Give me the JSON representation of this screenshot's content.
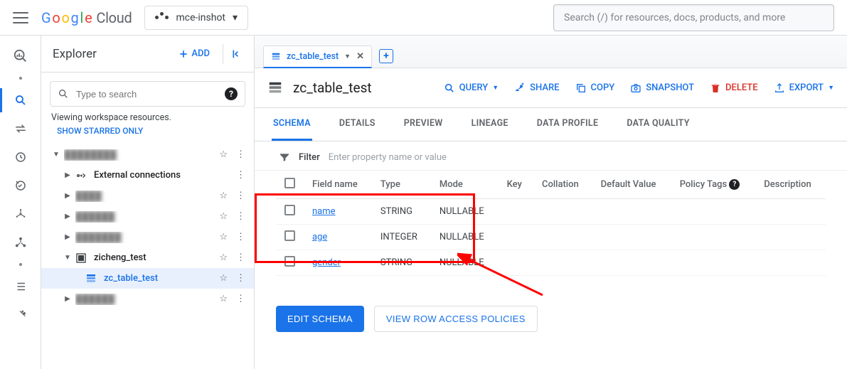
{
  "top": {
    "logo_cloud": "Cloud",
    "project": "mce-inshot",
    "search_placeholder": "Search (/) for resources, docs, products, and more"
  },
  "explorer": {
    "title": "Explorer",
    "add": "ADD",
    "search_placeholder": "Type to search",
    "viewing": "Viewing workspace resources.",
    "starred": "SHOW STARRED ONLY",
    "ext_conn": "External connections",
    "ds": "zicheng_test",
    "tbl": "zc_table_test"
  },
  "main": {
    "tab_label": "zc_table_test",
    "title": "zc_table_test",
    "actions": {
      "query": "QUERY",
      "share": "SHARE",
      "copy": "COPY",
      "snapshot": "SNAPSHOT",
      "delete": "DELETE",
      "export": "EXPORT"
    },
    "subtabs": [
      "SCHEMA",
      "DETAILS",
      "PREVIEW",
      "LINEAGE",
      "DATA PROFILE",
      "DATA QUALITY"
    ],
    "filter_label": "Filter",
    "filter_placeholder": "Enter property name or value",
    "cols": [
      "",
      "Field name",
      "Type",
      "Mode",
      "Key",
      "Collation",
      "Default Value",
      "Policy Tags",
      "Description"
    ],
    "rows": [
      {
        "name": "name",
        "type": "STRING",
        "mode": "NULLABLE"
      },
      {
        "name": "age",
        "type": "INTEGER",
        "mode": "NULLABLE"
      },
      {
        "name": "gender",
        "type": "STRING",
        "mode": "NULLABLE"
      }
    ],
    "btn_edit": "EDIT SCHEMA",
    "btn_policies": "VIEW ROW ACCESS POLICIES"
  }
}
